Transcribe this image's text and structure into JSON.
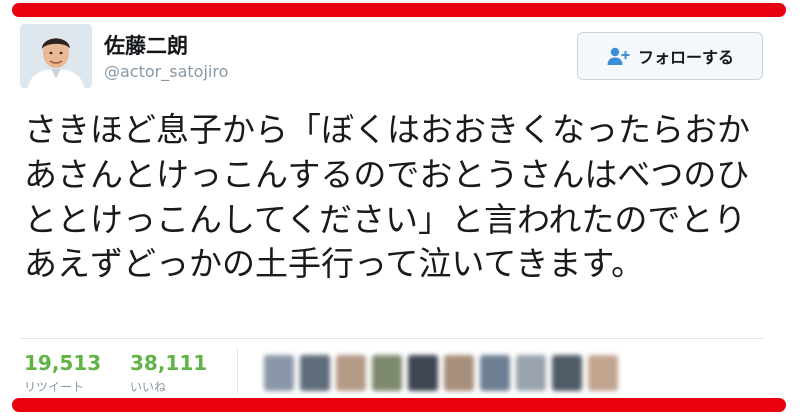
{
  "profile": {
    "display_name": "佐藤二朗",
    "username": "@actor_satojiro",
    "avatar_icon": "profile-photo"
  },
  "follow_button": {
    "label": "フォローする",
    "icon": "person-add-icon"
  },
  "tweet": {
    "text": "さきほど息子から「ぼくはおおきくなったらおかあさんとけっこんするのでおとうさんはべつのひととけっこんしてください」と言われたのでとりあえずどっかの土手行って泣いてきます。"
  },
  "stats": {
    "retweets_value": "19,513",
    "retweets_label": "リツイート",
    "likes_value": "38,111",
    "likes_label": "いいね"
  },
  "colors": {
    "highlight_bar": "#e8000f",
    "stat_number": "#62b346",
    "secondary_text": "#8899a6"
  }
}
